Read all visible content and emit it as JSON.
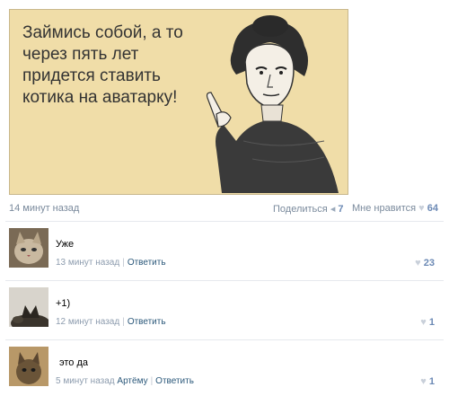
{
  "post": {
    "text": "Займись собой, а то через пять лет придется ставить котика на аватарку!",
    "time": "14 минут назад",
    "share_label": "Поделиться",
    "share_count": "7",
    "like_label": "Мне нравится",
    "like_count": "64"
  },
  "comments": [
    {
      "text": "Уже",
      "time": "13 минут назад",
      "reply_to": "",
      "reply": "Ответить",
      "likes": "23"
    },
    {
      "text": "+1)",
      "time": "12 минут назад",
      "reply_to": "",
      "reply": "Ответить",
      "likes": "1"
    },
    {
      "text": "это да",
      "time": "5 минут назад",
      "reply_to": "Артёму",
      "reply": "Ответить",
      "likes": "1"
    }
  ],
  "icons": {
    "heart": "heart-icon",
    "share": "share-arrow-icon"
  },
  "colors": {
    "card_bg": "#f0dda8",
    "link": "#2b587a",
    "meta": "#7a8a9c"
  }
}
